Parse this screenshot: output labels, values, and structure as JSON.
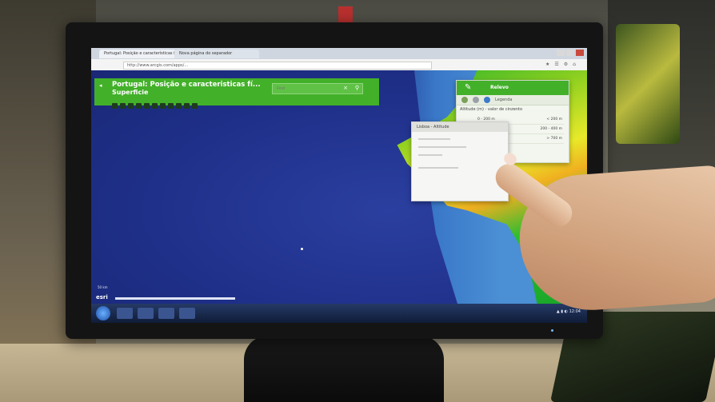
{
  "browser": {
    "tab1_title": "Portugal: Posição e características físicas",
    "tab2_title": "Nova página do separador",
    "url": "http://www.arcgis.com/apps/...",
    "window_controls": [
      "minimize",
      "maximize",
      "close"
    ]
  },
  "app": {
    "title_line1": "Portugal: Posição e caracteristicas fí...",
    "title_line2": "Superficie",
    "search_placeholder": "Find",
    "toolbar_icons": [
      "home-icon",
      "zoom-in-icon",
      "zoom-out-icon",
      "layers-icon",
      "legend-icon",
      "measure-icon",
      "share-icon",
      "print-icon",
      "basemap-icon",
      "bookmark-icon",
      "info-icon"
    ]
  },
  "layer_panel": {
    "title": "Relevo",
    "tab_label": "Legenda",
    "caption": "Altitude (m) - valor de cinzento",
    "rows": [
      {
        "label": "0 - 200 m",
        "value": "< 200 m"
      },
      {
        "label": "200 - 400 m",
        "value": "200 - 400 m"
      },
      {
        "label": "400 - 700 m",
        "value": "> 700 m"
      }
    ]
  },
  "popup": {
    "title": "Lisboa - Altitude"
  },
  "map": {
    "attribution": "esri",
    "scalebar_label": "50 km"
  },
  "taskbar": {
    "clock": "12:04"
  },
  "colors": {
    "accent_green": "#43b02a",
    "ocean": "#21338b",
    "taskbar": "#1a2a50"
  }
}
